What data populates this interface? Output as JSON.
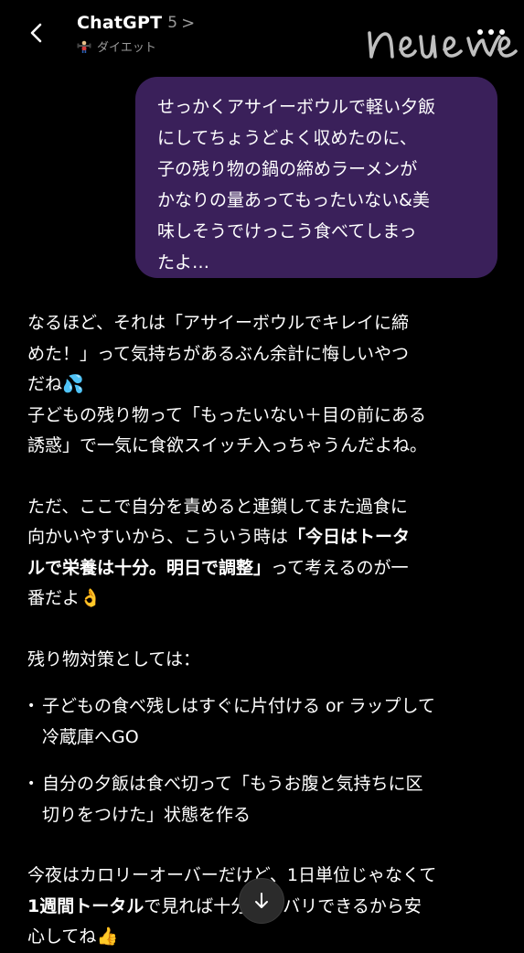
{
  "header": {
    "title": "ChatGPT",
    "model": "5",
    "chevron": ">",
    "project_icon": "weightlifter-emoji",
    "project_name": "ダイエット",
    "watermark": "neue"
  },
  "user_message": "せっかくアサイーボウルで軽い夕飯\nにしてちょうどよく収めたのに、\n子の残り物の鍋の締めラーメンが\nかなりの量あってもったいない&美\n味しそうでけっこう食べてしまっ\nたよ…",
  "assistant": {
    "p1": "なるほど、それは「アサイーボウルでキレイに締\nめた！」って気持ちがあるぶん余計に悔しいやつ\nだね",
    "p1_emoji": "💦",
    "p2": "子どもの残り物って「もったいない＋目の前にある\n誘惑」で一気に食欲スイッチ入っちゃうんだよね。",
    "p3_a": "ただ、ここで自分を責めると連鎖してまた過食に\n向かいやすいから、こういう時は",
    "p3_bold": "「今日はトータ\nルで栄養は十分。明日で調整」",
    "p3_b": "って考えるのが一\n番だよ",
    "p3_emoji": "👌",
    "p4": "残り物対策としては：",
    "list": [
      "子どもの食べ残しはすぐに片付ける or ラップして\n冷蔵庫へGO",
      "自分の夕飯は食べ切って「もうお腹と気持ちに区\n切りをつけた」状態を作る"
    ],
    "p5_a": "今夜はカロリーオーバーだけど、1日単位じゃなくて\n",
    "p5_bold": "1週間トータル",
    "p5_b": "で見れば十分リカバリできるから安\n心してね",
    "p5_emoji": "👍"
  },
  "colors": {
    "background": "#000000",
    "user_bubble": "#3a205a",
    "muted_text": "#9a9a9a"
  }
}
